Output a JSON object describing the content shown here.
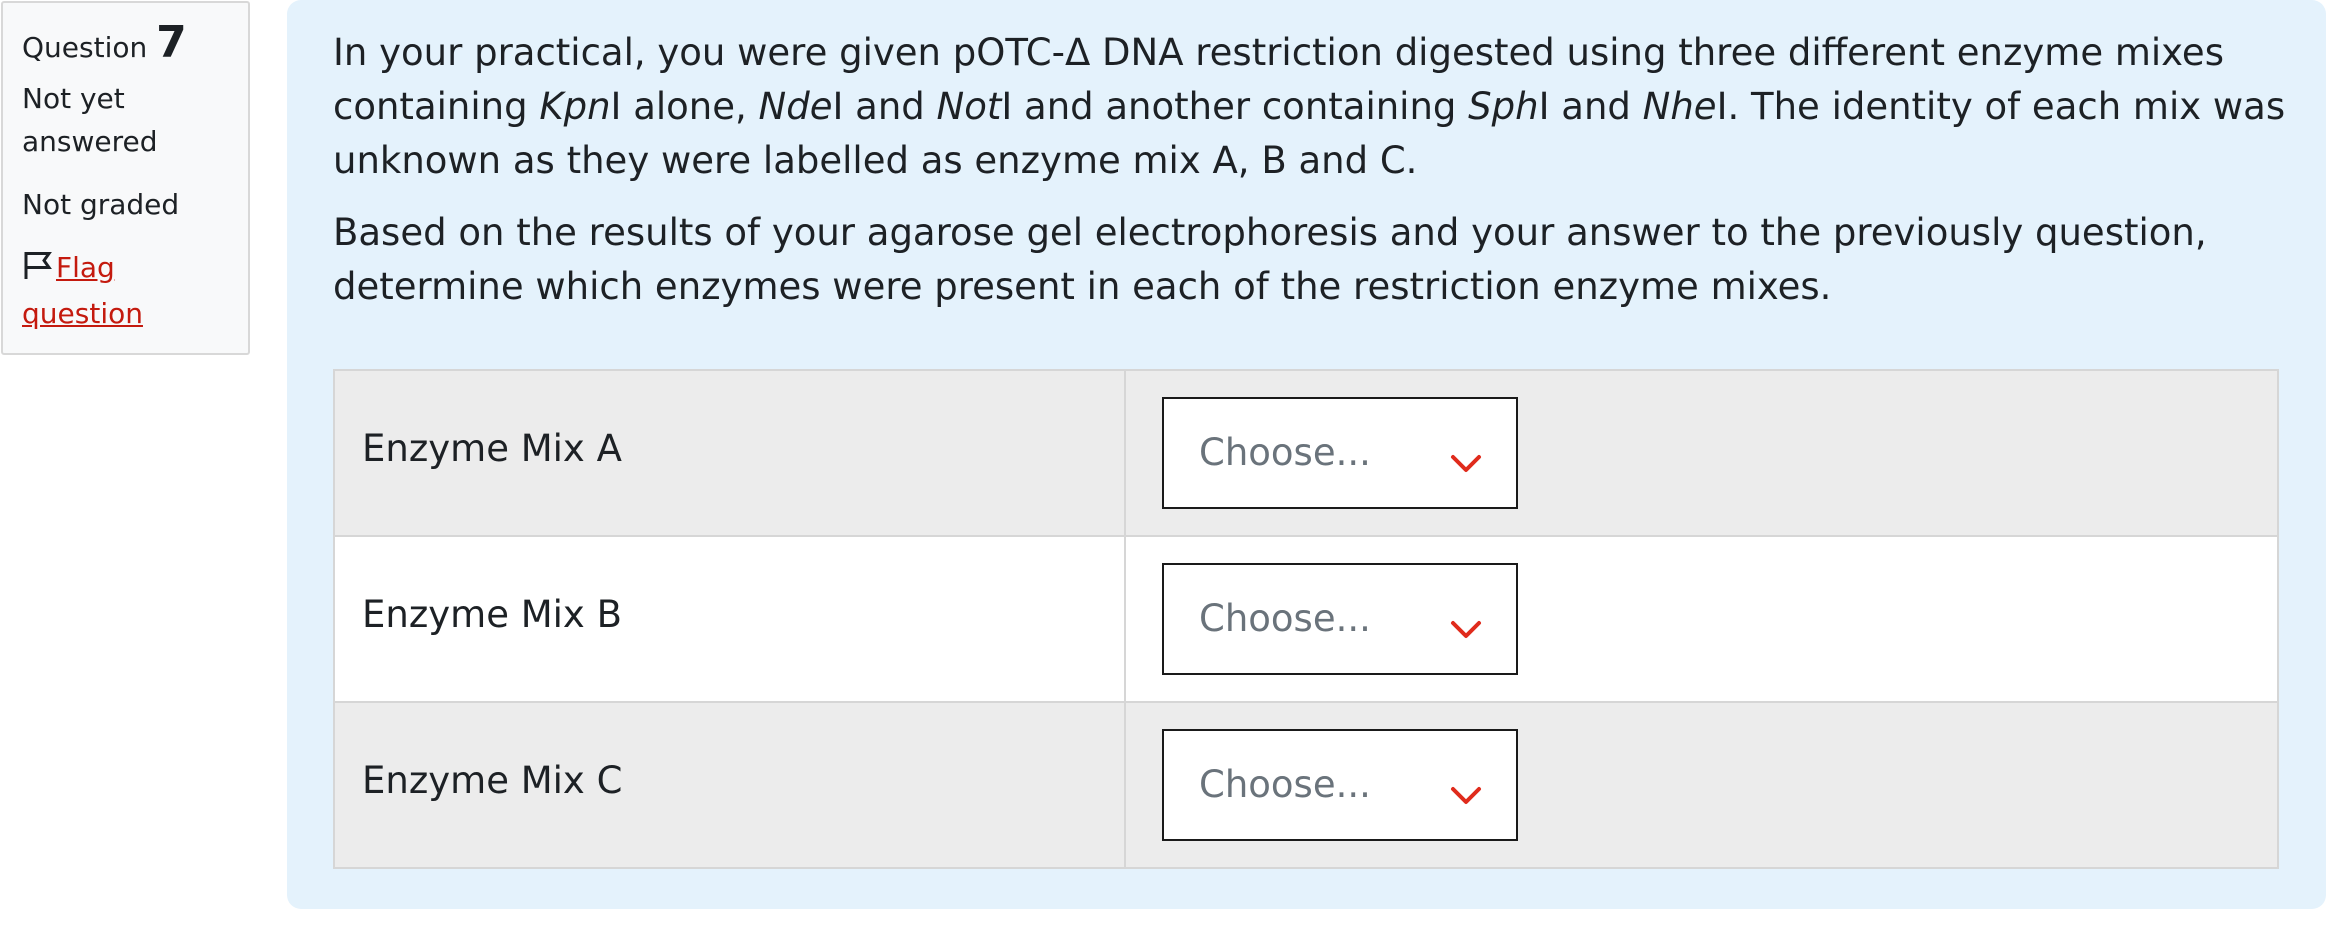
{
  "question_info": {
    "question_label": "Question",
    "question_number": "7",
    "state": "Not yet answered",
    "grade": "Not graded",
    "flag_link": "Flag question"
  },
  "question_text": {
    "p1": {
      "t1": "In your practical, you were given pOTC-Δ DNA restriction digested using three different enzyme mixes containing ",
      "e1": "Kpn",
      "t2": "I alone, ",
      "e2": "Nde",
      "t3": "I and ",
      "e3": "Not",
      "t4": "I and another containing ",
      "e4": "Sph",
      "t5": "I and ",
      "e5": "Nhe",
      "t6": "I. The identity of each mix was unknown as they were labelled as enzyme mix A, B and C."
    },
    "p2": "Based on the results of your agarose gel electrophoresis and your answer to the previously question, determine which enzymes were present in each of the restriction enzyme mixes."
  },
  "rows": [
    {
      "label": "Enzyme Mix A",
      "selected": "Choose..."
    },
    {
      "label": "Enzyme Mix B",
      "selected": "Choose..."
    },
    {
      "label": "Enzyme Mix C",
      "selected": "Choose..."
    }
  ],
  "colors": {
    "panel_background": "#e4f2fc",
    "flag_link": "#c41a0e",
    "chevron": "#e02b1c"
  },
  "icons": {
    "flag": "flag-outline-icon",
    "dropdown": "chevron-down-icon"
  }
}
